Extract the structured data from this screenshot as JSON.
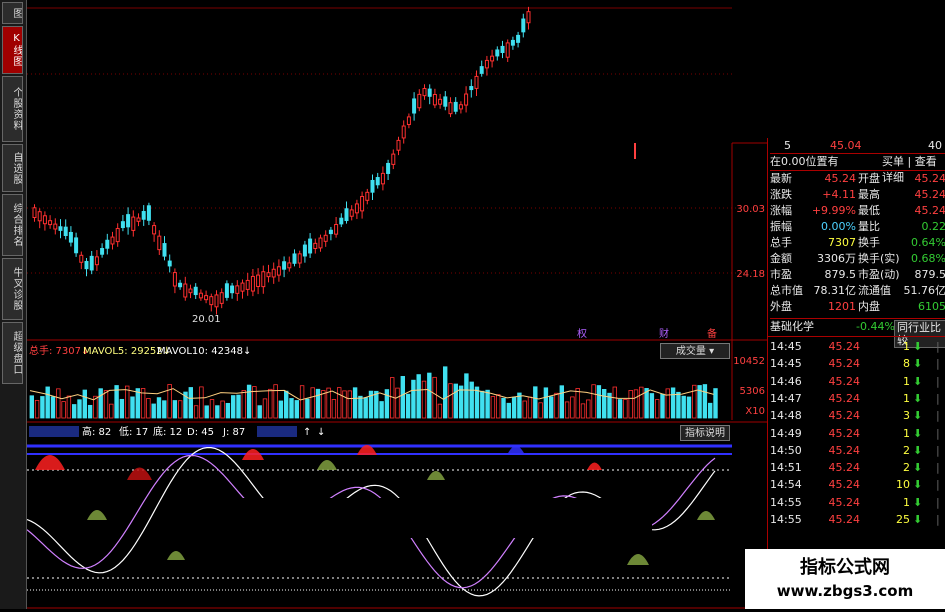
{
  "side_tabs": [
    "图",
    "K线图",
    "个股资料",
    "自选股",
    "综合排名",
    "牛叉诊股",
    "超级盘口"
  ],
  "main_chart": {
    "price_labels": [
      "30.03",
      "24.18"
    ],
    "low_marker": "20.01",
    "event_marks": [
      "权",
      "财",
      "备"
    ]
  },
  "volume_panel": {
    "legend_items": [
      "总手: 7307↓",
      "MAVOL5: 29252↓",
      "MAVOL10: 42348↓"
    ],
    "dropdown_label": "成交量",
    "axis_labels": [
      "10452",
      "5306",
      "X10"
    ]
  },
  "indicator_panel": {
    "legend_items": [
      "高: 82",
      "低: 17",
      "底: 12",
      "D: 45",
      "J: 87",
      "↑",
      "↓"
    ],
    "help_button": "指标说明"
  },
  "quote_panel": {
    "top_row": [
      "5",
      "45.04",
      "40"
    ],
    "subheader_left": "在0.00位置有",
    "subheader_right": "买单 | 查看详细",
    "stats": [
      {
        "l1": "最新",
        "v1": "45.24",
        "c1": "red",
        "l2": "开盘",
        "v2": "45.24",
        "c2": "red"
      },
      {
        "l1": "涨跌",
        "v1": "+4.11",
        "c1": "red",
        "l2": "最高",
        "v2": "45.24",
        "c2": "red"
      },
      {
        "l1": "涨幅",
        "v1": "+9.99%",
        "c1": "red",
        "l2": "最低",
        "v2": "45.24",
        "c2": "red"
      },
      {
        "l1": "振幅",
        "v1": "0.00%",
        "c1": "cyan",
        "l2": "量比",
        "v2": "0.22",
        "c2": "green"
      },
      {
        "l1": "总手",
        "v1": "7307",
        "c1": "yellow",
        "l2": "换手",
        "v2": "0.64%",
        "c2": "green"
      },
      {
        "l1": "金额",
        "v1": "3306万",
        "c1": "white",
        "l2": "换手(实)",
        "v2": "0.68%",
        "c2": "green"
      },
      {
        "l1": "市盈",
        "v1": "879.5",
        "c1": "white",
        "l2": "市盈(动)",
        "v2": "879.5",
        "c2": "white"
      },
      {
        "l1": "总市值",
        "v1": "78.31亿",
        "c1": "white",
        "l2": "流通值",
        "v2": "51.76亿",
        "c2": "white"
      },
      {
        "l1": "外盘",
        "v1": "1201",
        "c1": "red",
        "l2": "内盘",
        "v2": "6105",
        "c2": "green"
      }
    ],
    "sector_name": "基础化学",
    "sector_change": "-0.44%",
    "compare_button": "同行业比较",
    "ticks": [
      {
        "time": "14:45",
        "price": "45.24",
        "vol": "1"
      },
      {
        "time": "14:45",
        "price": "45.24",
        "vol": "8"
      },
      {
        "time": "14:46",
        "price": "45.24",
        "vol": "1"
      },
      {
        "time": "14:47",
        "price": "45.24",
        "vol": "1"
      },
      {
        "time": "14:48",
        "price": "45.24",
        "vol": "3"
      },
      {
        "time": "14:49",
        "price": "45.24",
        "vol": "1"
      },
      {
        "time": "14:50",
        "price": "45.24",
        "vol": "2"
      },
      {
        "time": "14:51",
        "price": "45.24",
        "vol": "2"
      },
      {
        "time": "14:54",
        "price": "45.24",
        "vol": "10"
      },
      {
        "time": "14:55",
        "price": "45.24",
        "vol": "1"
      },
      {
        "time": "14:55",
        "price": "45.24",
        "vol": "25"
      }
    ]
  },
  "watermark": {
    "title": "指标公式网",
    "url": "www.zbgs3.com"
  },
  "colors": {
    "up": "#ff3030",
    "down": "#40e0f0",
    "grid": "#800000",
    "accent": "#a00000"
  }
}
